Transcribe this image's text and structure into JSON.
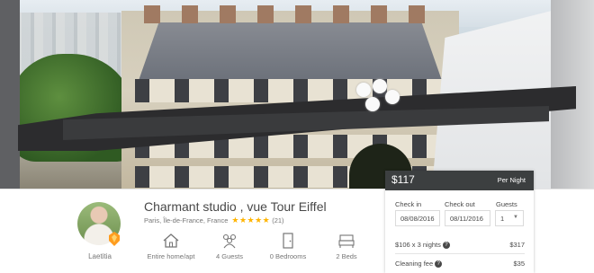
{
  "listing": {
    "title": "Charmant studio , vue Tour Eiffel",
    "location": "Paris, Île-de-France, France",
    "rating_stars": "★★★★★",
    "review_count": "(21)"
  },
  "host": {
    "name": "Laetitia"
  },
  "amenities": [
    {
      "icon": "house-icon",
      "label": "Entire home/apt"
    },
    {
      "icon": "guests-icon",
      "label": "4 Guests"
    },
    {
      "icon": "door-icon",
      "label": "0 Bedrooms"
    },
    {
      "icon": "bed-icon",
      "label": "2 Beds"
    }
  ],
  "booking": {
    "price": "$117",
    "per_night": "Per Night",
    "check_in_label": "Check in",
    "check_out_label": "Check out",
    "guests_label": "Guests",
    "check_in_value": "08/08/2016",
    "check_out_value": "08/11/2016",
    "guests_value": "1",
    "lines": [
      {
        "label": "$106 x 3 nights",
        "amount": "$317"
      },
      {
        "label": "Cleaning fee",
        "amount": "$35"
      }
    ]
  },
  "colors": {
    "price_bar": "#3c3f40",
    "star": "#ffb400",
    "text": "#484848",
    "muted": "#767676"
  }
}
